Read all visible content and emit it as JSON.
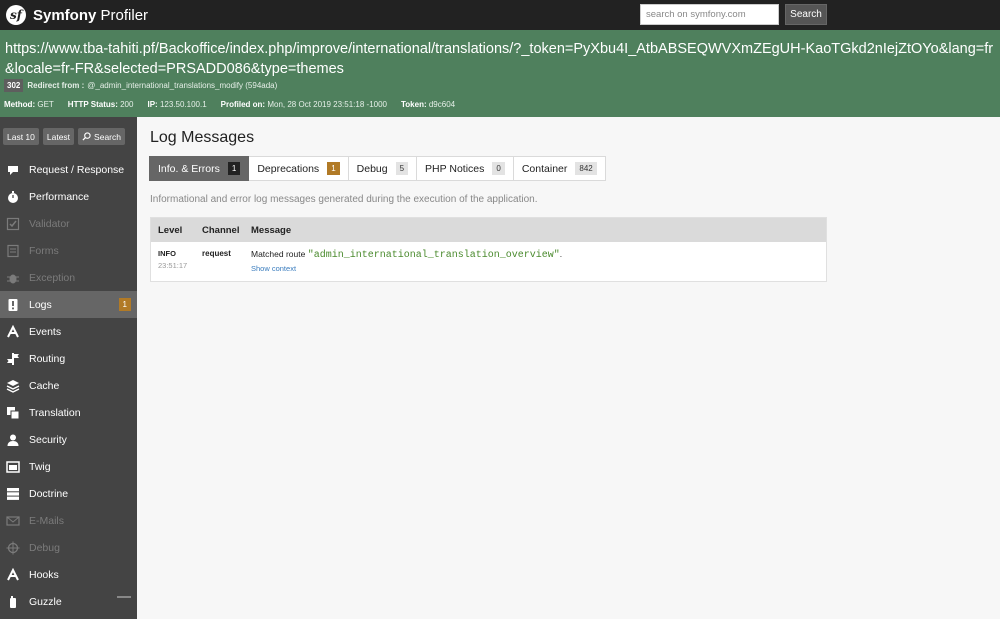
{
  "header": {
    "logo_glyph": "sf",
    "brand_bold": "Symfony",
    "brand_light": "Profiler",
    "search_placeholder": "search on symfony.com",
    "search_button": "Search"
  },
  "summary": {
    "url": "https://www.tba-tahiti.pf/Backoffice/index.php/improve/international/translations/?_token=PyXbu4I_AtbABSEQWVXmZEgUH-KaoTGkd2nIejZtOYo&lang=fr&locale=fr-FR&selected=PRSADD086&type=themes",
    "status_code": "302",
    "redirect_label": "Redirect from :",
    "redirect_route": "@_admin_international_translations_modify (594ada)",
    "meta": [
      {
        "label": "Method:",
        "value": "GET"
      },
      {
        "label": "HTTP Status:",
        "value": "200"
      },
      {
        "label": "IP:",
        "value": "123.50.100.1"
      },
      {
        "label": "Profiled on:",
        "value": "Mon, 28 Oct 2019 23:51:18 -1000"
      },
      {
        "label": "Token:",
        "value": "d9c604"
      }
    ]
  },
  "sidebar": {
    "buttons": {
      "last10": "Last 10",
      "latest": "Latest",
      "search": "Search"
    },
    "items": [
      {
        "label": "Request / Response",
        "icon": "request-icon"
      },
      {
        "label": "Performance",
        "icon": "stopwatch-icon"
      },
      {
        "label": "Validator",
        "icon": "check-icon"
      },
      {
        "label": "Forms",
        "icon": "form-icon"
      },
      {
        "label": "Exception",
        "icon": "bug-icon"
      },
      {
        "label": "Logs",
        "icon": "logs-icon",
        "badge": "1"
      },
      {
        "label": "Events",
        "icon": "events-icon"
      },
      {
        "label": "Routing",
        "icon": "signpost-icon"
      },
      {
        "label": "Cache",
        "icon": "cache-layers-icon"
      },
      {
        "label": "Translation",
        "icon": "translation-icon"
      },
      {
        "label": "Security",
        "icon": "user-icon"
      },
      {
        "label": "Twig",
        "icon": "twig-icon"
      },
      {
        "label": "Doctrine",
        "icon": "database-icon"
      },
      {
        "label": "E-Mails",
        "icon": "mail-icon"
      },
      {
        "label": "Debug",
        "icon": "crosshair-icon"
      },
      {
        "label": "Hooks",
        "icon": "hooks-icon"
      },
      {
        "label": "Guzzle",
        "icon": "guzzle-icon"
      }
    ]
  },
  "main": {
    "title": "Log Messages",
    "tabs": [
      {
        "label": "Info. & Errors",
        "count": "1"
      },
      {
        "label": "Deprecations",
        "count": "1"
      },
      {
        "label": "Debug",
        "count": "5"
      },
      {
        "label": "PHP Notices",
        "count": "0"
      },
      {
        "label": "Container",
        "count": "842"
      }
    ],
    "description": "Informational and error log messages generated during the execution of the application.",
    "table": {
      "headers": {
        "level": "Level",
        "channel": "Channel",
        "message": "Message"
      },
      "rows": [
        {
          "level": "INFO",
          "time": "23:51:17",
          "channel": "request",
          "message_prefix": "Matched route",
          "message_route": "\"admin_international_translation_overview\"",
          "message_suffix": ".",
          "link": "Show context"
        }
      ]
    }
  },
  "colors": {
    "header_bg": "#222222",
    "summary_bg": "#4f805d",
    "sidebar_bg": "#444444",
    "active_bg": "#666666",
    "badge_warn": "#b17a26",
    "route_green": "#4a8a2d",
    "link_blue": "#3b7dbe"
  }
}
